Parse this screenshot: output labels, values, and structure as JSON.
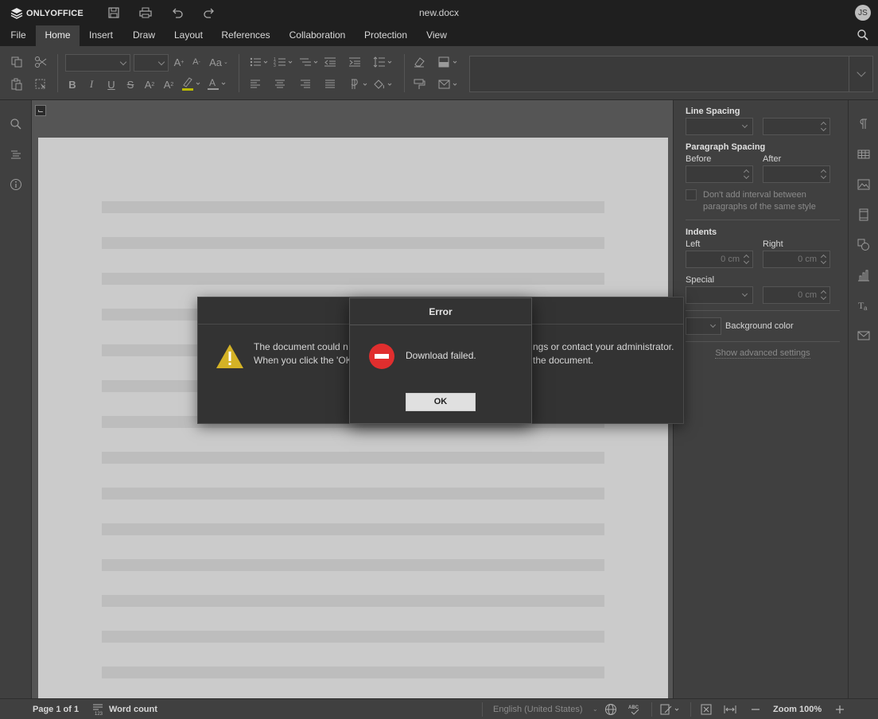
{
  "app": {
    "logo_text": "ONLYOFFICE",
    "doc_title": "new.docx",
    "avatar_initials": "JS"
  },
  "tabs": [
    {
      "label": "File"
    },
    {
      "label": "Home"
    },
    {
      "label": "Insert"
    },
    {
      "label": "Draw"
    },
    {
      "label": "Layout"
    },
    {
      "label": "References"
    },
    {
      "label": "Collaboration"
    },
    {
      "label": "Protection"
    },
    {
      "label": "View"
    }
  ],
  "active_tab": "Home",
  "right_panel": {
    "line_spacing_label": "Line Spacing",
    "paragraph_spacing_label": "Paragraph Spacing",
    "before_label": "Before",
    "after_label": "After",
    "no_interval_line1": "Don't add interval between",
    "no_interval_line2": "paragraphs of the same style",
    "indents_label": "Indents",
    "left_label": "Left",
    "right_label": "Right",
    "indent_left_value": "0 cm",
    "indent_right_value": "0 cm",
    "special_label": "Special",
    "special_value": "0 cm",
    "background_color_label": "Background color",
    "advanced_link": "Show advanced settings"
  },
  "status_bar": {
    "page_info": "Page 1 of 1",
    "word_count": "Word count",
    "language": "English (United States)",
    "zoom": "Zoom 100%"
  },
  "background_dialog": {
    "line1_left": "The document could n",
    "line1_right": "ngs or contact your administrator.",
    "line2_left": "When you click the 'OK",
    "line2_right": "the document."
  },
  "error_dialog": {
    "title": "Error",
    "message": "Download failed.",
    "ok_label": "OK"
  },
  "colors": {
    "toolbar_bg": "#404040",
    "page_bg": "#cbcbcb",
    "error_red": "#e02e2e",
    "warning_yellow": "#d4b226"
  }
}
